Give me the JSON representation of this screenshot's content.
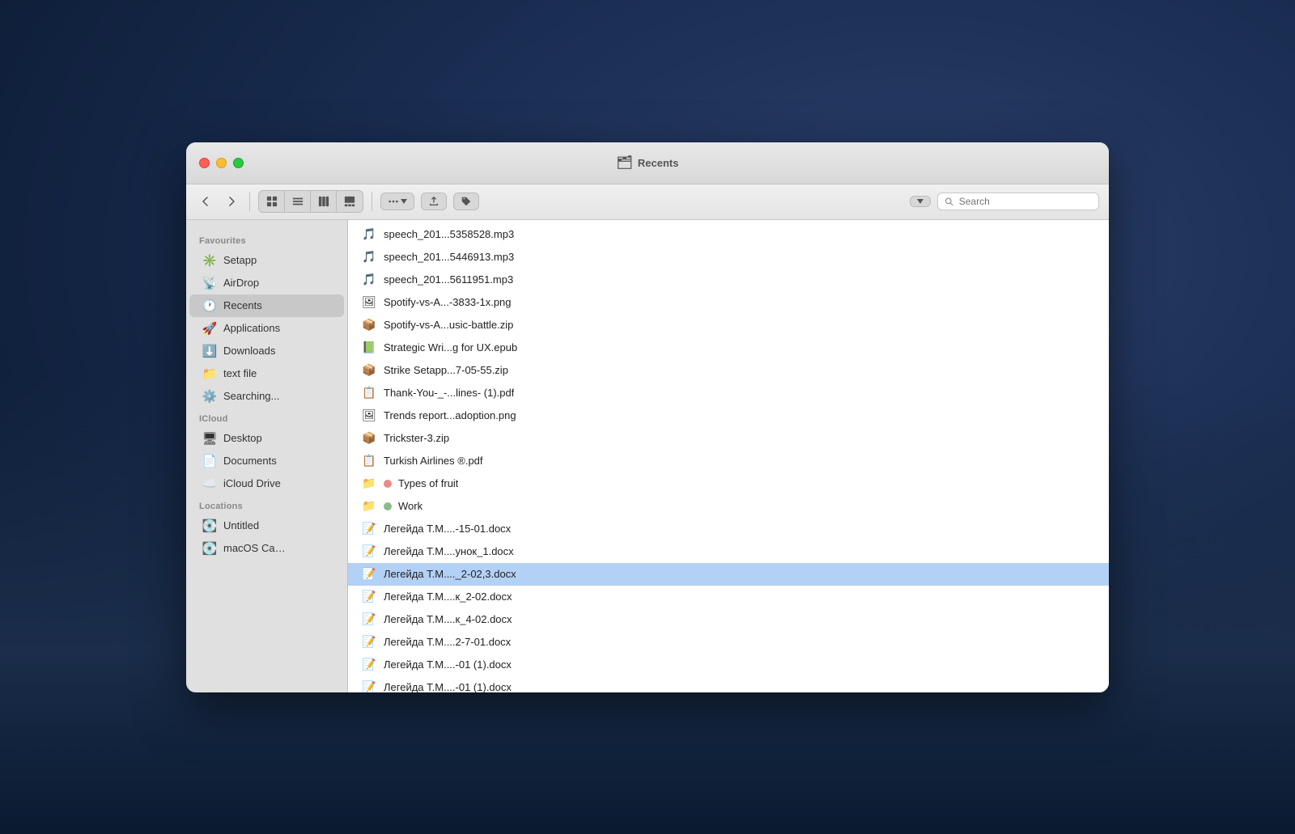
{
  "window": {
    "title": "Recents",
    "title_icon": "🗂"
  },
  "toolbar": {
    "back_label": "‹",
    "forward_label": "›",
    "search_placeholder": "Search",
    "search_value": ""
  },
  "sidebar": {
    "sections": [
      {
        "label": "Favourites",
        "items": [
          {
            "id": "setapp",
            "label": "Setapp",
            "icon": "✳️"
          },
          {
            "id": "airdrop",
            "label": "AirDrop",
            "icon": "📡"
          },
          {
            "id": "recents",
            "label": "Recents",
            "icon": "🕐",
            "active": true
          },
          {
            "id": "applications",
            "label": "Applications",
            "icon": "🚀"
          },
          {
            "id": "downloads",
            "label": "Downloads",
            "icon": "⬇️"
          },
          {
            "id": "text-file",
            "label": "text file",
            "icon": "📁"
          },
          {
            "id": "searching",
            "label": "Searching...",
            "icon": "⚙️"
          }
        ]
      },
      {
        "label": "iCloud",
        "items": [
          {
            "id": "desktop",
            "label": "Desktop",
            "icon": "🖥"
          },
          {
            "id": "documents",
            "label": "Documents",
            "icon": "📄"
          },
          {
            "id": "icloud-drive",
            "label": "iCloud Drive",
            "icon": "☁️"
          }
        ]
      },
      {
        "label": "Locations",
        "items": [
          {
            "id": "untitled",
            "label": "Untitled",
            "icon": "💽"
          },
          {
            "id": "macos-ca",
            "label": "macOS Ca…",
            "icon": "💽"
          }
        ]
      }
    ]
  },
  "files": [
    {
      "id": 1,
      "name": "speech_201...5358528.mp3",
      "icon": "🎵",
      "selected": false
    },
    {
      "id": 2,
      "name": "speech_201...5446913.mp3",
      "icon": "🎵",
      "selected": false
    },
    {
      "id": 3,
      "name": "speech_201...5611951.mp3",
      "icon": "🎵",
      "selected": false
    },
    {
      "id": 4,
      "name": "Spotify-vs-A...-3833-1x.png",
      "icon": "🖼",
      "selected": false
    },
    {
      "id": 5,
      "name": "Spotify-vs-A...usic-battle.zip",
      "icon": "📦",
      "selected": false
    },
    {
      "id": 6,
      "name": "Strategic Wri...g for UX.epub",
      "icon": "📗",
      "selected": false
    },
    {
      "id": 7,
      "name": "Strike Setapp...7-05-55.zip",
      "icon": "📦",
      "selected": false
    },
    {
      "id": 8,
      "name": "Thank-You-_-...lines- (1).pdf",
      "icon": "📋",
      "selected": false
    },
    {
      "id": 9,
      "name": "Trends report...adoption.png",
      "icon": "🖼",
      "selected": false
    },
    {
      "id": 10,
      "name": "Trickster-3.zip",
      "icon": "📦",
      "selected": false
    },
    {
      "id": 11,
      "name": "Turkish Airlines ®.pdf",
      "icon": "📋",
      "selected": false
    },
    {
      "id": 12,
      "name": "Types of fruit",
      "icon": "📁",
      "selected": false,
      "tag": "#e88"
    },
    {
      "id": 13,
      "name": "Work",
      "icon": "📁",
      "selected": false,
      "tag": "#8b8"
    },
    {
      "id": 14,
      "name": "Легейда Т.М....-15-01.docx",
      "icon": "📝",
      "selected": false
    },
    {
      "id": 15,
      "name": "Легейда Т.М....унок_1.docx",
      "icon": "📝",
      "selected": false
    },
    {
      "id": 16,
      "name": "Легейда Т.М...._2-02,3.docx",
      "icon": "📝",
      "selected": true
    },
    {
      "id": 17,
      "name": "Легейда Т.М....к_2-02.docx",
      "icon": "📝",
      "selected": false
    },
    {
      "id": 18,
      "name": "Легейда Т.М....к_4-02.docx",
      "icon": "📝",
      "selected": false
    },
    {
      "id": 19,
      "name": "Легейда Т.М....2-7-01.docx",
      "icon": "📝",
      "selected": false
    },
    {
      "id": 20,
      "name": "Легейда Т.М....-01 (1).docx",
      "icon": "📝",
      "selected": false
    },
    {
      "id": 21,
      "name": "Легейда Т.М....-01 (1).docx",
      "icon": "📝",
      "selected": false
    }
  ]
}
